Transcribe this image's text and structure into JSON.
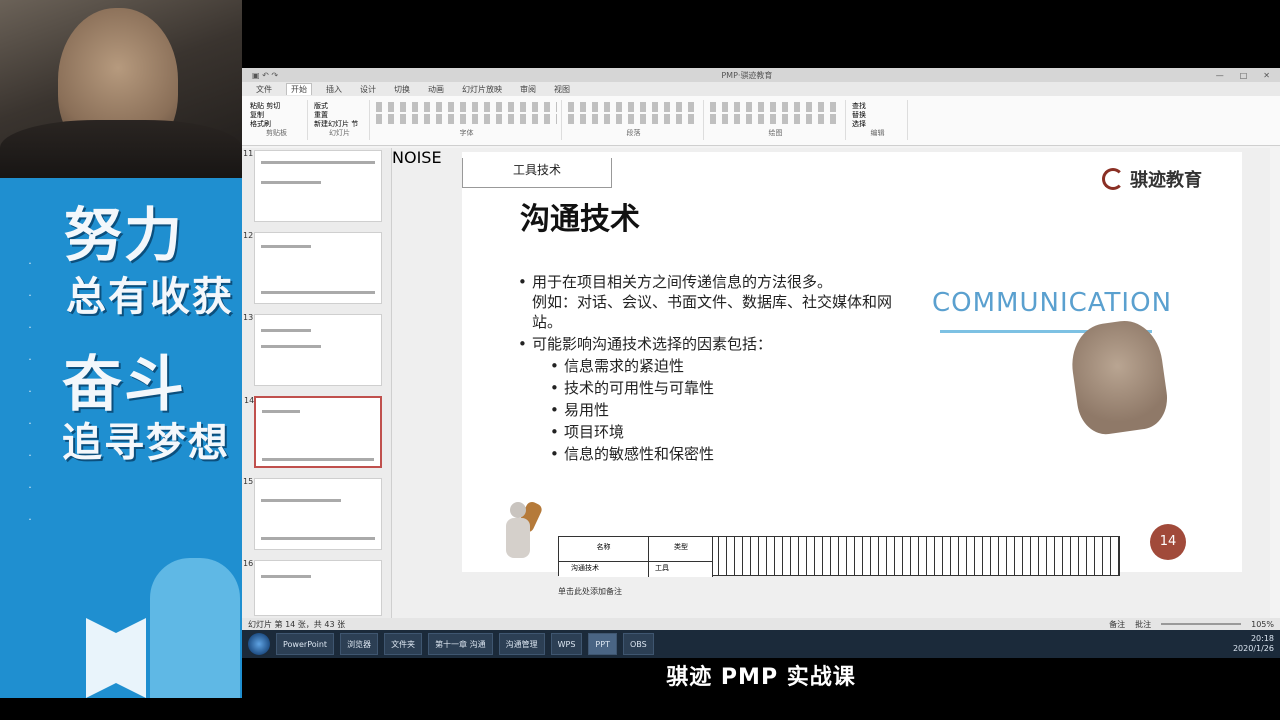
{
  "banner": {
    "line1": "努力",
    "line2": "总有收获",
    "line3": "奋斗",
    "line4": "追寻梦想"
  },
  "app": {
    "title": "PMP·骐迹教育",
    "tabs": [
      "文件",
      "开始",
      "插入",
      "设计",
      "切换",
      "动画",
      "幻灯片放映",
      "审阅",
      "视图"
    ],
    "active_tab": "开始",
    "ribbon_groups": [
      "剪贴板",
      "幻灯片",
      "字体",
      "段落",
      "绘图",
      "编辑"
    ],
    "ribbon_items": {
      "cut": "剪切",
      "copy": "复制",
      "format_painter": "格式刷",
      "paste": "粘贴",
      "new_slide": "新建幻灯片",
      "layout": "版式",
      "reset": "重置",
      "section": "节",
      "find": "查找",
      "replace": "替换",
      "select": "选择"
    }
  },
  "thumbnails": [
    {
      "num": "11"
    },
    {
      "num": "12"
    },
    {
      "num": "13"
    },
    {
      "num": "14",
      "active": true
    },
    {
      "num": "15"
    },
    {
      "num": "16"
    }
  ],
  "slide": {
    "tool_tab": "工具技术",
    "brand": "骐迹教育",
    "title": "沟通技术",
    "bullet1": "用于在项目相关方之间传递信息的方法很多。",
    "bullet1_cont": "例如：对话、会议、书面文件、数据库、社交媒体和网站。",
    "bullet2": "可能影响沟通技术选择的因素包括：",
    "subs": [
      "信息需求的紧迫性",
      "技术的可用性与可靠性",
      "易用性",
      "项目环境",
      "信息的敏感性和保密性"
    ],
    "comm_word": "COMMUNICATION",
    "gantt_col1": "名称",
    "gantt_col2": "类型",
    "gantt_task": "沟通技术",
    "gantt_type": "工具",
    "page_number": "14",
    "noise": "NOISE",
    "notes_text": "单击此处添加备注"
  },
  "statusbar": {
    "left": "幻灯片 第 14 张，共 43 张",
    "notes": "备注",
    "comments": "批注",
    "zoom": "105%"
  },
  "taskbar": {
    "items": [
      "PowerPoint",
      "浏览器",
      "文件夹",
      "第十一章 沟通",
      "沟通管理",
      "WPS",
      "PPT",
      "OBS"
    ],
    "time": "20:18",
    "date": "2020/1/26"
  },
  "caption": "骐迹 PMP 实战课"
}
